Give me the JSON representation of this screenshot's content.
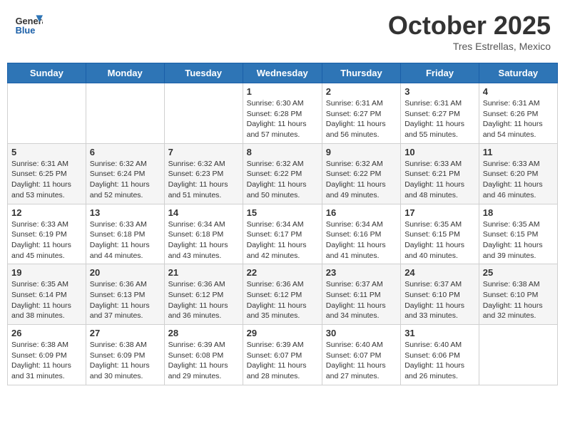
{
  "header": {
    "logo_general": "General",
    "logo_blue": "Blue",
    "month": "October 2025",
    "location": "Tres Estrellas, Mexico"
  },
  "days_of_week": [
    "Sunday",
    "Monday",
    "Tuesday",
    "Wednesday",
    "Thursday",
    "Friday",
    "Saturday"
  ],
  "weeks": [
    [
      {
        "day": "",
        "info": ""
      },
      {
        "day": "",
        "info": ""
      },
      {
        "day": "",
        "info": ""
      },
      {
        "day": "1",
        "info": "Sunrise: 6:30 AM\nSunset: 6:28 PM\nDaylight: 11 hours and 57 minutes."
      },
      {
        "day": "2",
        "info": "Sunrise: 6:31 AM\nSunset: 6:27 PM\nDaylight: 11 hours and 56 minutes."
      },
      {
        "day": "3",
        "info": "Sunrise: 6:31 AM\nSunset: 6:27 PM\nDaylight: 11 hours and 55 minutes."
      },
      {
        "day": "4",
        "info": "Sunrise: 6:31 AM\nSunset: 6:26 PM\nDaylight: 11 hours and 54 minutes."
      }
    ],
    [
      {
        "day": "5",
        "info": "Sunrise: 6:31 AM\nSunset: 6:25 PM\nDaylight: 11 hours and 53 minutes."
      },
      {
        "day": "6",
        "info": "Sunrise: 6:32 AM\nSunset: 6:24 PM\nDaylight: 11 hours and 52 minutes."
      },
      {
        "day": "7",
        "info": "Sunrise: 6:32 AM\nSunset: 6:23 PM\nDaylight: 11 hours and 51 minutes."
      },
      {
        "day": "8",
        "info": "Sunrise: 6:32 AM\nSunset: 6:22 PM\nDaylight: 11 hours and 50 minutes."
      },
      {
        "day": "9",
        "info": "Sunrise: 6:32 AM\nSunset: 6:22 PM\nDaylight: 11 hours and 49 minutes."
      },
      {
        "day": "10",
        "info": "Sunrise: 6:33 AM\nSunset: 6:21 PM\nDaylight: 11 hours and 48 minutes."
      },
      {
        "day": "11",
        "info": "Sunrise: 6:33 AM\nSunset: 6:20 PM\nDaylight: 11 hours and 46 minutes."
      }
    ],
    [
      {
        "day": "12",
        "info": "Sunrise: 6:33 AM\nSunset: 6:19 PM\nDaylight: 11 hours and 45 minutes."
      },
      {
        "day": "13",
        "info": "Sunrise: 6:33 AM\nSunset: 6:18 PM\nDaylight: 11 hours and 44 minutes."
      },
      {
        "day": "14",
        "info": "Sunrise: 6:34 AM\nSunset: 6:18 PM\nDaylight: 11 hours and 43 minutes."
      },
      {
        "day": "15",
        "info": "Sunrise: 6:34 AM\nSunset: 6:17 PM\nDaylight: 11 hours and 42 minutes."
      },
      {
        "day": "16",
        "info": "Sunrise: 6:34 AM\nSunset: 6:16 PM\nDaylight: 11 hours and 41 minutes."
      },
      {
        "day": "17",
        "info": "Sunrise: 6:35 AM\nSunset: 6:15 PM\nDaylight: 11 hours and 40 minutes."
      },
      {
        "day": "18",
        "info": "Sunrise: 6:35 AM\nSunset: 6:15 PM\nDaylight: 11 hours and 39 minutes."
      }
    ],
    [
      {
        "day": "19",
        "info": "Sunrise: 6:35 AM\nSunset: 6:14 PM\nDaylight: 11 hours and 38 minutes."
      },
      {
        "day": "20",
        "info": "Sunrise: 6:36 AM\nSunset: 6:13 PM\nDaylight: 11 hours and 37 minutes."
      },
      {
        "day": "21",
        "info": "Sunrise: 6:36 AM\nSunset: 6:12 PM\nDaylight: 11 hours and 36 minutes."
      },
      {
        "day": "22",
        "info": "Sunrise: 6:36 AM\nSunset: 6:12 PM\nDaylight: 11 hours and 35 minutes."
      },
      {
        "day": "23",
        "info": "Sunrise: 6:37 AM\nSunset: 6:11 PM\nDaylight: 11 hours and 34 minutes."
      },
      {
        "day": "24",
        "info": "Sunrise: 6:37 AM\nSunset: 6:10 PM\nDaylight: 11 hours and 33 minutes."
      },
      {
        "day": "25",
        "info": "Sunrise: 6:38 AM\nSunset: 6:10 PM\nDaylight: 11 hours and 32 minutes."
      }
    ],
    [
      {
        "day": "26",
        "info": "Sunrise: 6:38 AM\nSunset: 6:09 PM\nDaylight: 11 hours and 31 minutes."
      },
      {
        "day": "27",
        "info": "Sunrise: 6:38 AM\nSunset: 6:09 PM\nDaylight: 11 hours and 30 minutes."
      },
      {
        "day": "28",
        "info": "Sunrise: 6:39 AM\nSunset: 6:08 PM\nDaylight: 11 hours and 29 minutes."
      },
      {
        "day": "29",
        "info": "Sunrise: 6:39 AM\nSunset: 6:07 PM\nDaylight: 11 hours and 28 minutes."
      },
      {
        "day": "30",
        "info": "Sunrise: 6:40 AM\nSunset: 6:07 PM\nDaylight: 11 hours and 27 minutes."
      },
      {
        "day": "31",
        "info": "Sunrise: 6:40 AM\nSunset: 6:06 PM\nDaylight: 11 hours and 26 minutes."
      },
      {
        "day": "",
        "info": ""
      }
    ]
  ]
}
